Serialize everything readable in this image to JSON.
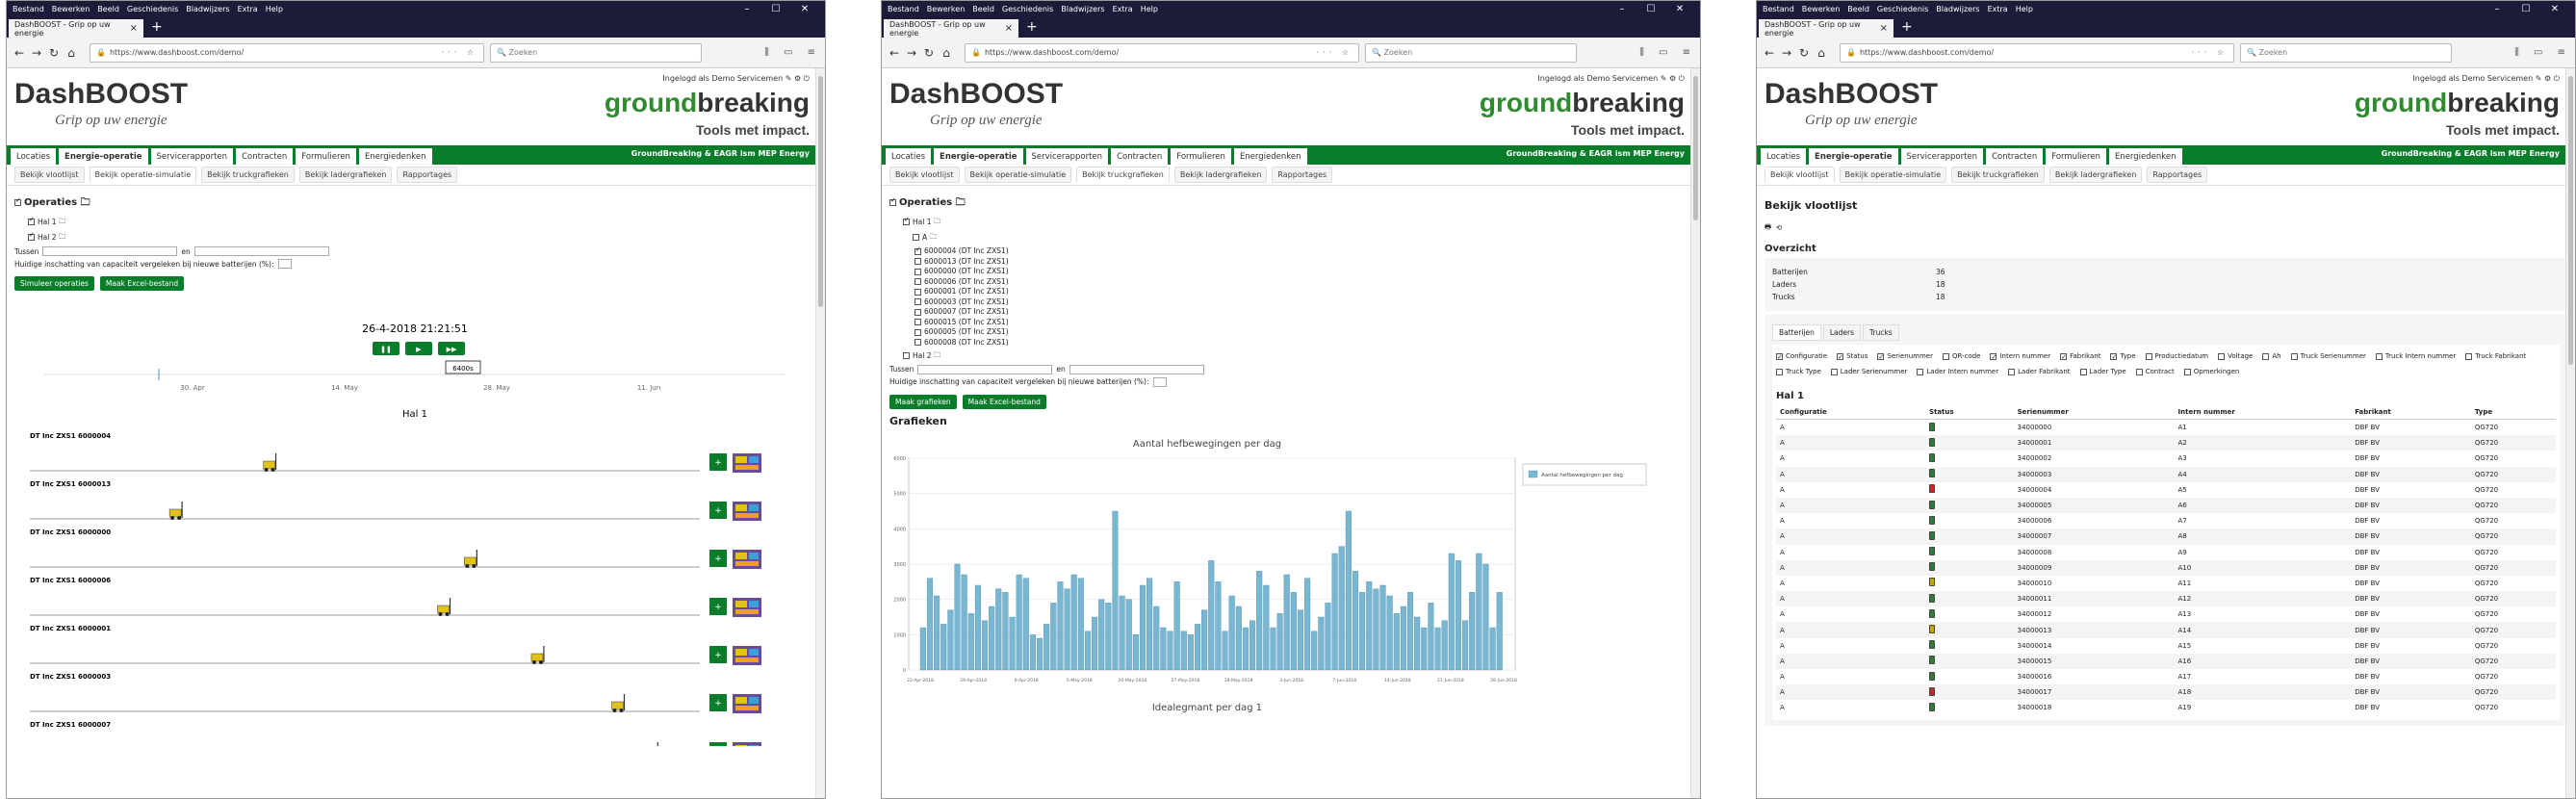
{
  "browser": {
    "menu": [
      "Bestand",
      "Bewerken",
      "Beeld",
      "Geschiedenis",
      "Bladwijzers",
      "Extra",
      "Help"
    ],
    "tab_title": "DashBOOST - Grip op uw energie",
    "url_host": "www.dashboost.com",
    "url_full": "https://www.dashboost.com/demo/",
    "search_placeholder": "Zoeken"
  },
  "header": {
    "logo": "DashBOOST",
    "slogan": "Grip op uw energie",
    "login": "Ingelogd als Demo Servicemen",
    "brand_a": "ground",
    "brand_b": "breaking",
    "brand_tag": "Tools met impact.",
    "nav_tagline": "GroundBreaking & EAGR ism MEP Energy"
  },
  "nav": [
    "Locaties",
    "Energie-operatie",
    "Servicerapporten",
    "Contracten",
    "Formulieren",
    "Energiedenken"
  ],
  "subnav": [
    "Bekijk vlootlijst",
    "Bekijk operatie-simulatie",
    "Bekijk truckgrafieken",
    "Bekijk ladergrafieken",
    "Rapportages"
  ],
  "common": {
    "operaties": "Operaties",
    "tussen": "Tussen",
    "en": "en",
    "capacity_q": "Huidige inschatting van capaciteit vergeleken bij nieuwe batterijen (%):",
    "btn_excel": "Maak Excel-bestand"
  },
  "p1": {
    "hal1": "Hal 1",
    "hal2": "Hal 2",
    "btn_simulate": "Simuleer operaties",
    "datetime": "26-4-2018 21:21:51",
    "tooltip": "6400s",
    "timeline": [
      "30. Apr",
      "14. May",
      "28. May",
      "11. Jun"
    ],
    "section": "Hal 1",
    "trucks": [
      {
        "label": "DT Inc ZXS1 6000004",
        "pos": 0.36
      },
      {
        "label": "DT Inc ZXS1 6000013",
        "pos": 0.22
      },
      {
        "label": "DT Inc ZXS1 6000000",
        "pos": 0.66
      },
      {
        "label": "DT Inc ZXS1 6000006",
        "pos": 0.62
      },
      {
        "label": "DT Inc ZXS1 6000001",
        "pos": 0.76
      },
      {
        "label": "DT Inc ZXS1 6000003",
        "pos": 0.88
      },
      {
        "label": "DT Inc ZXS1 6000007",
        "pos": 0.93
      }
    ]
  },
  "p2": {
    "hal1": "Hal 1",
    "group": "A",
    "devices": [
      "6000004 (DT Inc ZXS1)",
      "6000013 (DT Inc ZXS1)",
      "6000000 (DT Inc ZXS1)",
      "6000006 (DT Inc ZXS1)",
      "6000001 (DT Inc ZXS1)",
      "6000003 (DT Inc ZXS1)",
      "6000007 (DT Inc ZXS1)",
      "6000015 (DT Inc ZXS1)",
      "6000005 (DT Inc ZXS1)",
      "6000008 (DT Inc ZXS1)"
    ],
    "hal2": "Hal 2",
    "btn_graph": "Maak grafieken",
    "section": "Grafieken",
    "next_title": "Idealegmant per dag 1"
  },
  "p3": {
    "title": "Bekijk vlootlijst",
    "overview": "Overzicht",
    "stats": [
      {
        "k": "Batterijen",
        "v": "36"
      },
      {
        "k": "Laders",
        "v": "18"
      },
      {
        "k": "Trucks",
        "v": "18"
      }
    ],
    "tabs": [
      "Batterijen",
      "Laders",
      "Trucks"
    ],
    "cols": [
      [
        "Configuratie",
        true
      ],
      [
        "Status",
        true
      ],
      [
        "Serienummer",
        true
      ],
      [
        "QR-code",
        false
      ],
      [
        "Intern nummer",
        true
      ],
      [
        "Fabrikant",
        true
      ],
      [
        "Type",
        true
      ],
      [
        "Productiedatum",
        false
      ],
      [
        "Voltage",
        false
      ],
      [
        "Ah",
        false
      ],
      [
        "Truck Serienummer",
        false
      ],
      [
        "Truck Intern nummer",
        false
      ],
      [
        "Truck Fabrikant",
        false
      ],
      [
        "Truck Type",
        false
      ],
      [
        "Lader Serienummer",
        false
      ],
      [
        "Lader Intern nummer",
        false
      ],
      [
        "Lader Fabrikant",
        false
      ],
      [
        "Lader Type",
        false
      ],
      [
        "Contract",
        false
      ],
      [
        "Opmerkingen",
        false
      ]
    ],
    "hal": "Hal 1",
    "headers": [
      "Configuratie",
      "Status",
      "Serienummer",
      "Intern nummer",
      "Fabrikant",
      "Type"
    ],
    "rows": [
      [
        "A",
        "34000000",
        "A1",
        "DBF BV",
        "QG720"
      ],
      [
        "A",
        "34000001",
        "A2",
        "DBF BV",
        "QG720"
      ],
      [
        "A",
        "34000002",
        "A3",
        "DBF BV",
        "QG720"
      ],
      [
        "A",
        "34000003",
        "A4",
        "DBF BV",
        "QG720"
      ],
      [
        "A",
        "34000004",
        "A5",
        "DBF BV",
        "QG720"
      ],
      [
        "A",
        "34000005",
        "A6",
        "DBF BV",
        "QG720"
      ],
      [
        "A",
        "34000006",
        "A7",
        "DBF BV",
        "QG720"
      ],
      [
        "A",
        "34000007",
        "A8",
        "DBF BV",
        "QG720"
      ],
      [
        "A",
        "34000008",
        "A9",
        "DBF BV",
        "QG720"
      ],
      [
        "A",
        "34000009",
        "A10",
        "DBF BV",
        "QG720"
      ],
      [
        "A",
        "34000010",
        "A11",
        "DBF BV",
        "QG720"
      ],
      [
        "A",
        "34000011",
        "A12",
        "DBF BV",
        "QG720"
      ],
      [
        "A",
        "34000012",
        "A13",
        "DBF BV",
        "QG720"
      ],
      [
        "A",
        "34000013",
        "A14",
        "DBF BV",
        "QG720"
      ],
      [
        "A",
        "34000014",
        "A15",
        "DBF BV",
        "QG720"
      ],
      [
        "A",
        "34000015",
        "A16",
        "DBF BV",
        "QG720"
      ],
      [
        "A",
        "34000016",
        "A17",
        "DBF BV",
        "QG720"
      ],
      [
        "A",
        "34000017",
        "A18",
        "DBF BV",
        "QG720"
      ],
      [
        "A",
        "34000018",
        "A19",
        "DBF BV",
        "QG720"
      ]
    ],
    "status_colors": [
      "#2e7d32",
      "#2e7d32",
      "#2e7d32",
      "#2e7d32",
      "#c62828",
      "#2e7d32",
      "#2e7d32",
      "#2e7d32",
      "#2e7d32",
      "#2e7d32",
      "#c9a400",
      "#2e7d32",
      "#2e7d32",
      "#c9a400",
      "#2e7d32",
      "#2e7d32",
      "#2e7d32",
      "#c62828",
      "#2e7d32"
    ]
  },
  "chart_data": {
    "type": "bar",
    "title": "Aantal hefbewegingen per dag",
    "series": [
      {
        "name": "Aantal hefbewegingen per dag",
        "values": [
          1200,
          2600,
          2100,
          1300,
          1700,
          3000,
          2700,
          1600,
          2400,
          1400,
          1800,
          2300,
          2200,
          1500,
          2700,
          2600,
          1000,
          900,
          1300,
          1900,
          2500,
          2300,
          2700,
          2600,
          1100,
          1500,
          2000,
          1900,
          4500,
          2100,
          2000,
          1000,
          2400,
          2600,
          1800,
          1200,
          1100,
          2500,
          1100,
          1000,
          1300,
          1700,
          3100,
          2500,
          1100,
          2100,
          1800,
          1200,
          1400,
          2800,
          2400,
          1200,
          1600,
          2700,
          2200,
          1700,
          2600,
          1100,
          1500,
          1900,
          3300,
          3500,
          4500,
          2800,
          2200,
          2500,
          2300,
          2400,
          2100,
          1600,
          1800,
          2200,
          1500,
          1200,
          1900,
          1200,
          1400,
          3300,
          3100,
          1400,
          2200,
          3300,
          3000,
          1200,
          2200
        ]
      }
    ],
    "x_ticks": [
      "22-Apr-2018",
      "29-Apr-2018",
      "6-Apr-2018",
      "5-May-2018",
      "20-May-2018",
      "27-May-2018",
      "28-May-2018",
      "3-Jun-2018",
      "7-Jun-2018",
      "14-Jun-2018",
      "21-Jun-2018",
      "28-Jun-2018"
    ],
    "y_ticks": [
      "0",
      "1000",
      "2000",
      "3000",
      "4000",
      "5000",
      "6000"
    ],
    "ylim": [
      0,
      6000
    ]
  }
}
